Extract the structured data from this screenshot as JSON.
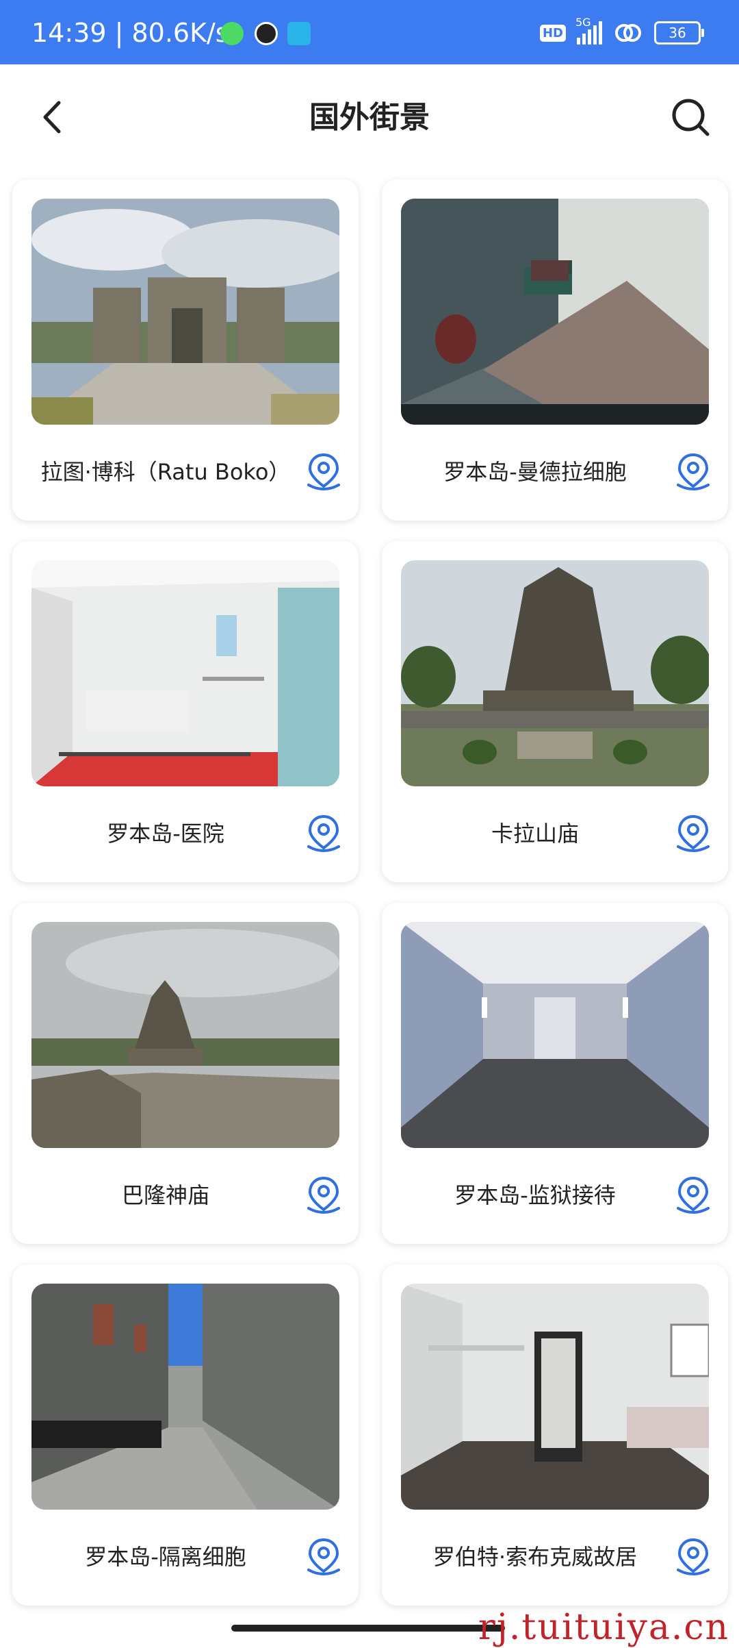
{
  "status_bar": {
    "time": "14:39 | 80.6K/s",
    "network": "5G",
    "hd_label": "HD",
    "battery": "36",
    "color": "#3c7cf0"
  },
  "header": {
    "title": "国外街景",
    "back_icon": "chevron-left-icon",
    "search_icon": "search-icon"
  },
  "cards": [
    {
      "label": "拉图·博科（Ratu Boko）",
      "scene": "temple-gate"
    },
    {
      "label": "罗本岛-曼德拉细胞",
      "scene": "prison-cell"
    },
    {
      "label": "罗本岛-医院",
      "scene": "hospital-room"
    },
    {
      "label": "卡拉山庙",
      "scene": "stone-temple"
    },
    {
      "label": "巴隆神庙",
      "scene": "hill-temple"
    },
    {
      "label": "罗本岛-监狱接待",
      "scene": "corridor"
    },
    {
      "label": "罗本岛-隔离细胞",
      "scene": "courtyard"
    },
    {
      "label": "罗伯特·索布克威故居",
      "scene": "house-interior"
    }
  ],
  "pin_icon": "location-pin-icon",
  "accent_color": "#2f6fdf",
  "watermark": "rj.tuituiya.cn"
}
